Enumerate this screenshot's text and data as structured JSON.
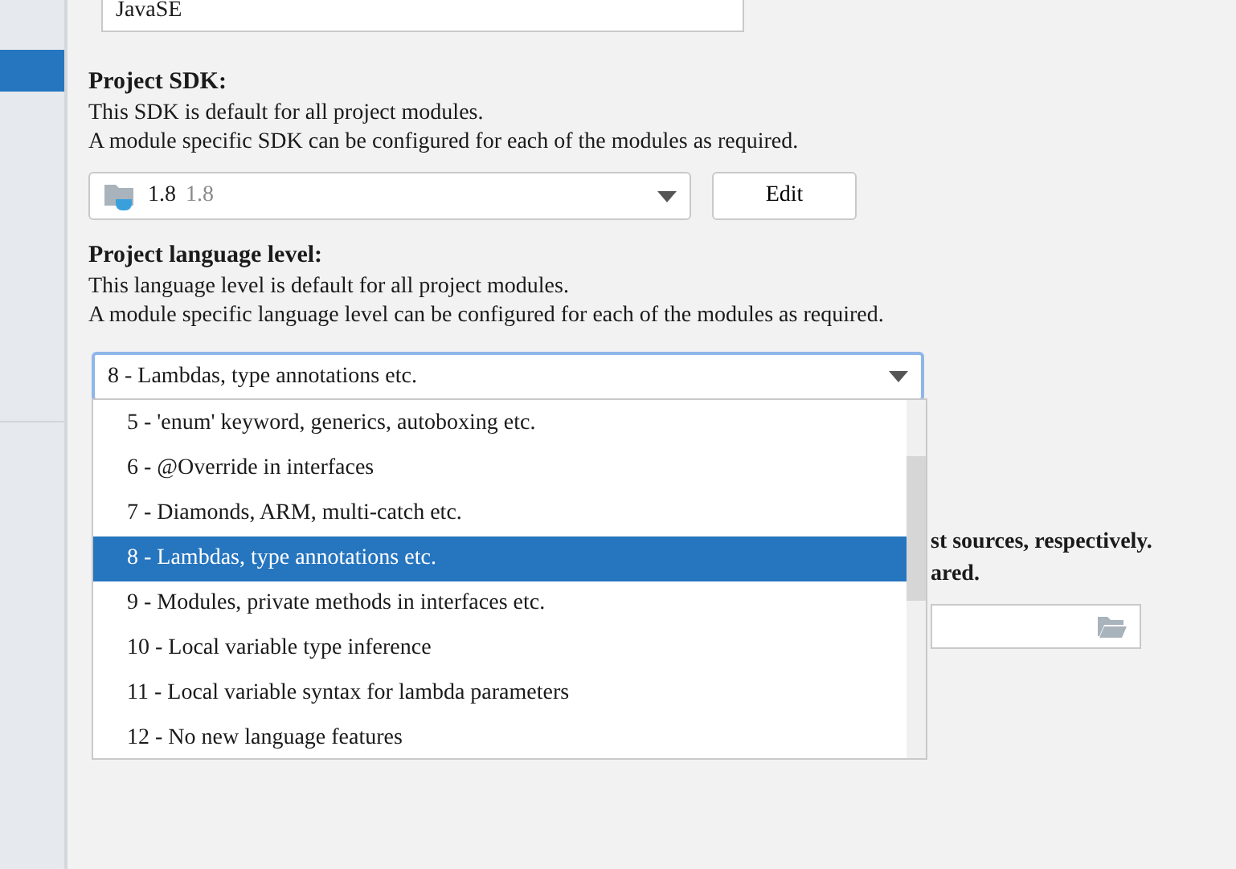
{
  "project_name_field": {
    "value": "JavaSE"
  },
  "sidebar": {
    "items": [
      {
        "selected": true
      }
    ]
  },
  "project_sdk": {
    "heading": "Project SDK:",
    "lines": [
      "This SDK is default for all project modules.",
      "A module specific SDK can be configured for each of the modules as required."
    ],
    "combo": {
      "name": "1.8",
      "version": "1.8"
    },
    "edit_button": "Edit"
  },
  "language_level": {
    "heading": "Project language level:",
    "lines": [
      "This language level is default for all project modules.",
      "A module specific language level can be configured for each of the modules as required."
    ],
    "combo": {
      "value": "8 - Lambdas, type annotations etc.",
      "focused": true
    },
    "options": [
      {
        "label": "5 - 'enum' keyword, generics, autoboxing etc.",
        "selected": false
      },
      {
        "label": "6 - @Override in interfaces",
        "selected": false
      },
      {
        "label": "7 - Diamonds, ARM, multi-catch etc.",
        "selected": false
      },
      {
        "label": "8 - Lambdas, type annotations etc.",
        "selected": true
      },
      {
        "label": "9 - Modules, private methods in interfaces etc.",
        "selected": false
      },
      {
        "label": "10 - Local variable type inference",
        "selected": false
      },
      {
        "label": "11 - Local variable syntax for lambda parameters",
        "selected": false
      },
      {
        "label": "12 - No new language features",
        "selected": false
      }
    ]
  },
  "covered_section": {
    "right_fragments": [
      "st sources, respectively.",
      "ared."
    ]
  }
}
